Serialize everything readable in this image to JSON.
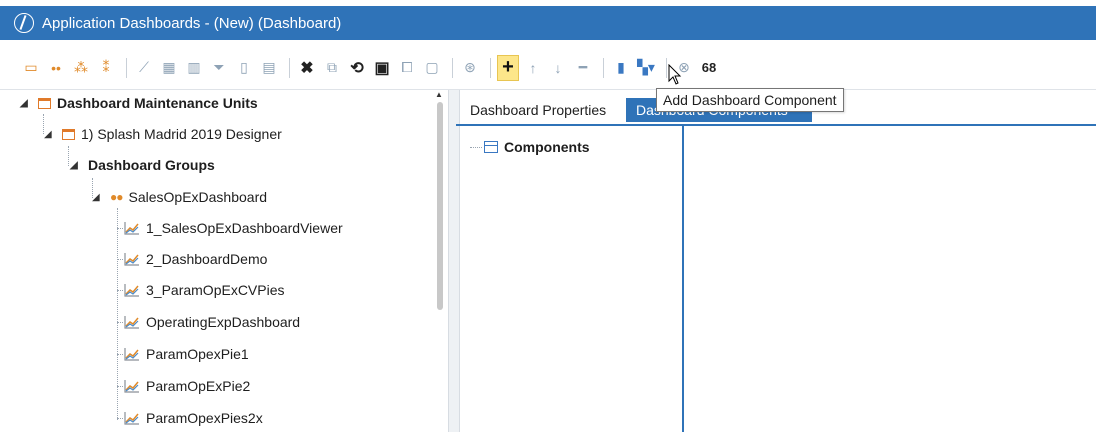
{
  "window": {
    "title": "Application Dashboards - (New) (Dashboard)"
  },
  "tooltip": {
    "text": "Add Dashboard Component"
  },
  "toolbar": {
    "highlighted": "add-dashboard-component",
    "extra_label": "68"
  },
  "tree": {
    "root": "Dashboard Maintenance Units",
    "unit": "1) Splash Madrid 2019 Designer",
    "groups_label": "Dashboard Groups",
    "group": "SalesOpExDashboard",
    "dashboards": [
      "1_SalesOpExDashboardViewer",
      "2_DashboardDemo",
      "3_ParamOpExCVPies",
      "OperatingExpDashboard",
      "ParamOpexPie1",
      "ParamOpExPie2",
      "ParamOpexPies2x"
    ]
  },
  "tabs": [
    {
      "label": "Dashboard Properties",
      "active": false
    },
    {
      "label": "Dashboard Components",
      "active": true
    }
  ],
  "components_panel": {
    "root": "Components"
  },
  "colors": {
    "accent": "#2f73b8",
    "orange": "#e07a2a",
    "highlight": "#fde68a"
  }
}
